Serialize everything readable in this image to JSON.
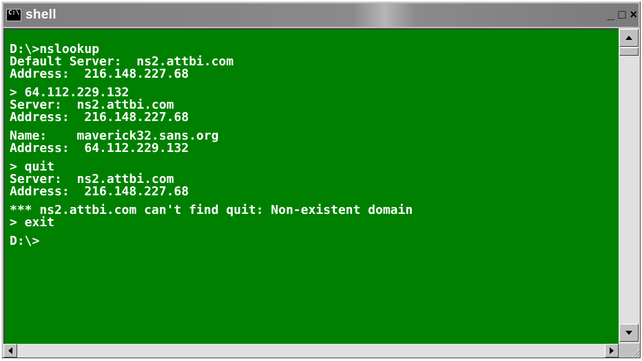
{
  "window": {
    "title": "shell",
    "icon_text": "C:\\",
    "controls": {
      "minimize": "_",
      "maximize": "□",
      "close": "×"
    }
  },
  "console": {
    "lines": [
      "D:\\>nslookup",
      "Default Server:  ns2.attbi.com",
      "Address:  216.148.227.68",
      "",
      "> 64.112.229.132",
      "Server:  ns2.attbi.com",
      "Address:  216.148.227.68",
      "",
      "Name:    maverick32.sans.org",
      "Address:  64.112.229.132",
      "",
      "> quit",
      "Server:  ns2.attbi.com",
      "Address:  216.148.227.68",
      "",
      "*** ns2.attbi.com can't find quit: Non-existent domain",
      "> exit",
      "",
      "D:\\>"
    ]
  },
  "colors": {
    "console_bg": "#008000",
    "console_fg": "#ffffff",
    "titlebar_inactive": "#808080"
  },
  "icons": {
    "app": "console-icon",
    "scroll_up": "arrow-up-icon",
    "scroll_down": "arrow-down-icon",
    "scroll_left": "arrow-left-icon",
    "scroll_right": "arrow-right-icon"
  }
}
